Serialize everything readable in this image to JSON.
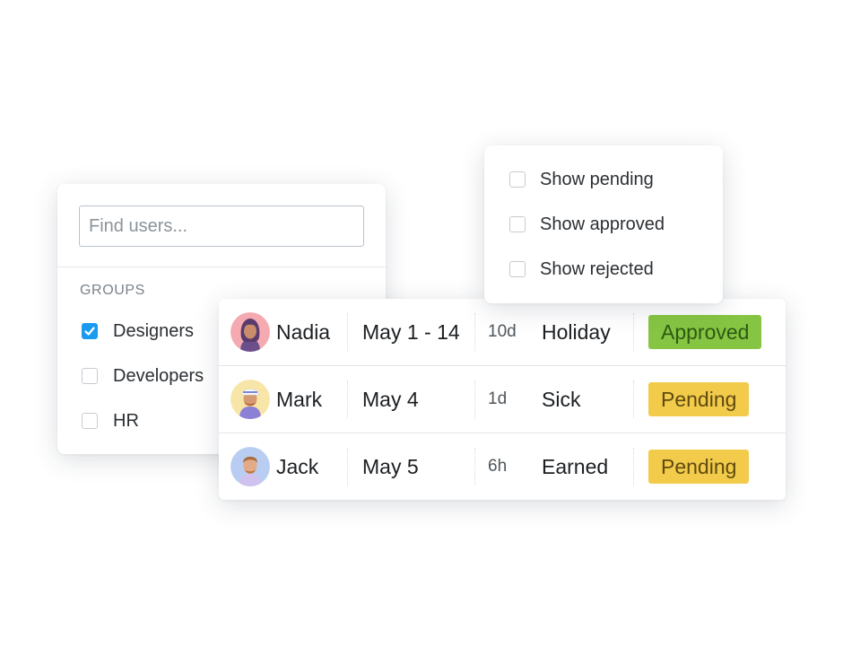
{
  "users_panel": {
    "search": {
      "placeholder": "Find users...",
      "value": ""
    },
    "groups_label": "GROUPS",
    "groups": [
      {
        "label": "Designers",
        "checked": true
      },
      {
        "label": "Developers",
        "checked": false
      },
      {
        "label": "HR",
        "checked": false
      }
    ]
  },
  "status_menu": {
    "options": [
      {
        "label": "Show pending",
        "checked": false
      },
      {
        "label": "Show approved",
        "checked": false
      },
      {
        "label": "Show rejected",
        "checked": false
      }
    ]
  },
  "timeoff": {
    "rows": [
      {
        "name": "Nadia",
        "avatar": "avatar-woman-icon",
        "date": "May 1 - 14",
        "duration": "10d",
        "type": "Holiday",
        "status": "Approved"
      },
      {
        "name": "Mark",
        "avatar": "avatar-man-cap-icon",
        "date": "May 4",
        "duration": "1d",
        "type": "Sick",
        "status": "Pending"
      },
      {
        "name": "Jack",
        "avatar": "avatar-man-icon",
        "date": "May 5",
        "duration": "6h",
        "type": "Earned",
        "status": "Pending"
      }
    ]
  },
  "colors": {
    "checkbox_checked": "#1a9bf0",
    "approved": "#86c543",
    "pending": "#f2cb4b"
  }
}
